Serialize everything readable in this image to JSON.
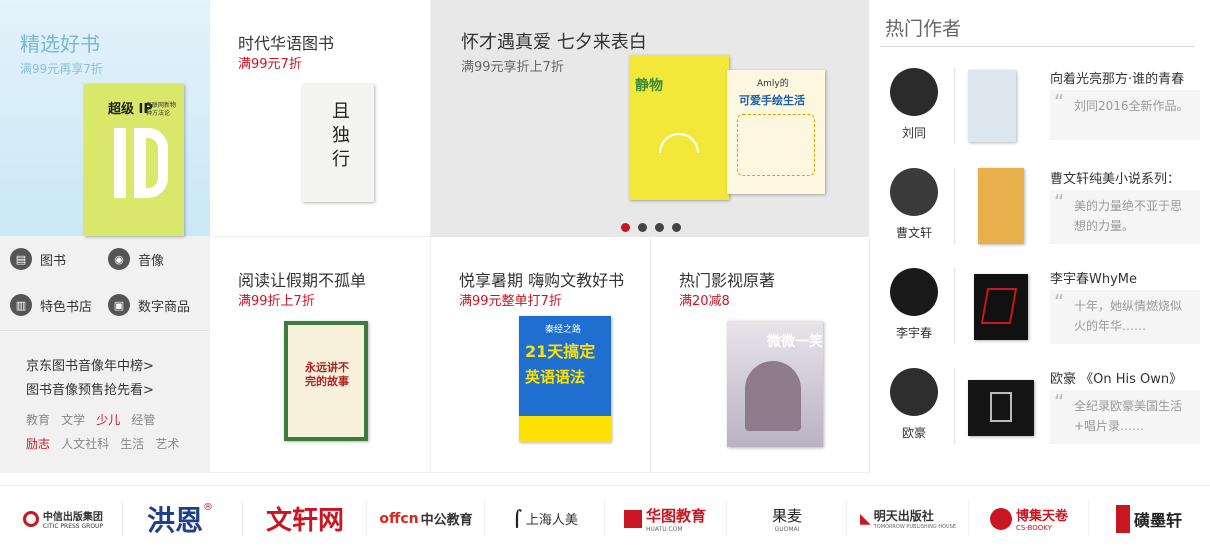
{
  "left": {
    "promo_title": "精选好书",
    "promo_sub": "满99元再享7折",
    "book_title": "超级 IP",
    "book_sub": "互联网新物种方法论",
    "categories": [
      {
        "label": "图书",
        "icon": "book-icon"
      },
      {
        "label": "音像",
        "icon": "disc-icon"
      },
      {
        "label": "特色书店",
        "icon": "store-icon"
      },
      {
        "label": "数字商品",
        "icon": "digital-icon"
      }
    ],
    "links": [
      "京东图书音像年中榜>",
      "图书音像预售抢先看>"
    ],
    "tags_row1": [
      "教育",
      "文学",
      "少儿",
      "经管"
    ],
    "tags_row2": [
      "励志",
      "人文社科",
      "生活",
      "艺术"
    ]
  },
  "cells": {
    "c1": {
      "title": "时代华语图书",
      "sub": "满99元7折",
      "cover_text": "且 独行"
    },
    "banner": {
      "title": "怀才遇真爱 七夕来表白",
      "sub": "满99元享折上7折",
      "cover_a": "静物",
      "cover_b": "可爱手绘生活",
      "cover_b_top": "Amly的"
    },
    "c2": {
      "title": "阅读让假期不孤单",
      "sub": "满99折上7折",
      "cover_text": "永远讲不完的故事"
    },
    "c3": {
      "title": "悦享暑期 嗨购文教好书",
      "sub": "满99元整单打7折",
      "cover_num": "21天搞定",
      "cover_text": "英语语法",
      "cover_top": "秦经之路"
    },
    "c4": {
      "title": "热门影视原著",
      "sub": "满20减8",
      "cover_text": "微微一笑"
    }
  },
  "right": {
    "heading": "热门作者",
    "authors": [
      {
        "name": "刘同",
        "title": "向着光亮那方·谁的青春",
        "quote": "刘同2016全新作品。"
      },
      {
        "name": "曹文轩",
        "title": "曹文轩纯美小说系列：",
        "quote": "美的力量绝不亚于思想的力量。"
      },
      {
        "name": "李宇春",
        "title": "李宇春WhyMe",
        "quote": "十年，她纵情燃烧似火的年华……"
      },
      {
        "name": "欧豪",
        "title": "欧豪 《On His Own》",
        "quote": "全纪录欧豪美国生活+唱片录……"
      }
    ]
  },
  "brands": [
    {
      "name": "中信出版集团",
      "sub": "CITIC PRESS GROUP"
    },
    {
      "name": "洪恩",
      "sub": "®"
    },
    {
      "name": "文轩网",
      "sub": ""
    },
    {
      "name": "中公教育",
      "sub": "offcn"
    },
    {
      "name": "上海人美",
      "sub": ""
    },
    {
      "name": "华图教育",
      "sub": "HUATU.COM"
    },
    {
      "name": "果麦",
      "sub": "GUOMAI"
    },
    {
      "name": "明天出版社",
      "sub": "TOMORROW PUBLISHING HOUSE"
    },
    {
      "name": "博集天卷",
      "sub": "CS-BOOKY"
    },
    {
      "name": "磺墨轩",
      "sub": ""
    }
  ],
  "colors": {
    "accent": "#c81623",
    "promo_blue": "#7ab7d5"
  }
}
